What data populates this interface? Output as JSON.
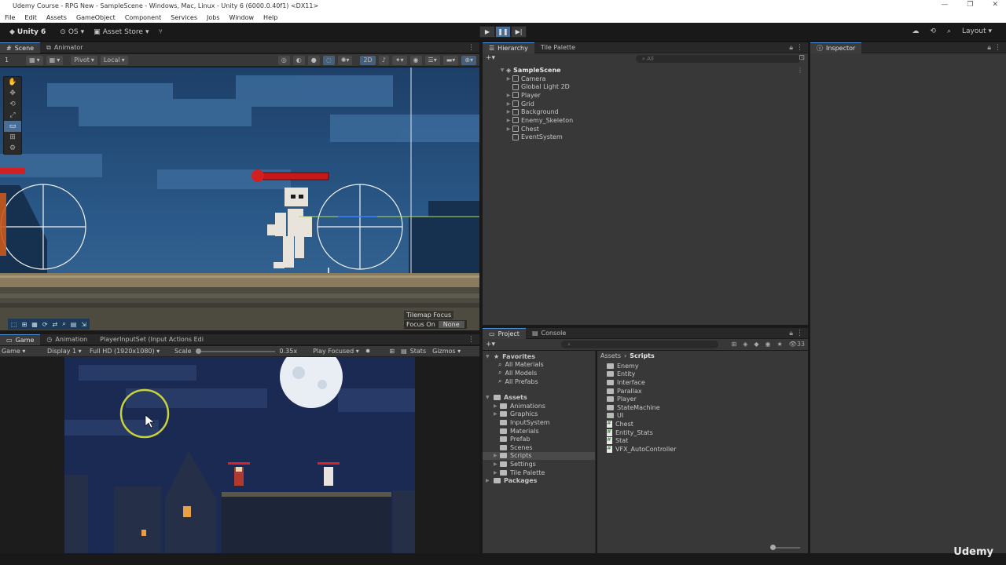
{
  "window": {
    "title": "Udemy Course - RPG New - SampleScene - Windows, Mac, Linux - Unity 6 (6000.0.40f1) <DX11>",
    "controls": [
      "—",
      "❐",
      "✕"
    ]
  },
  "menu": [
    "File",
    "Edit",
    "Assets",
    "GameObject",
    "Component",
    "Services",
    "Jobs",
    "Window",
    "Help"
  ],
  "toolbar": {
    "account": "Unity 6",
    "os": "OS",
    "asset_store": "Asset Store",
    "layout": "Layout"
  },
  "scene_panel": {
    "tabs": [
      "Scene",
      "Animator"
    ],
    "pivot": "Pivot",
    "local": "Local",
    "layer_num": "1",
    "mode_2d": "2D",
    "tilemap_focus": "Tilemap Focus",
    "focus_on_label": "Focus On",
    "focus_on_value": "None"
  },
  "game_panel": {
    "tabs": [
      "Game",
      "Animation",
      "PlayerInputSet (Input Actions Edi"
    ],
    "view_mode": "Game",
    "display": "Display 1",
    "resolution": "Full HD (1920x1080)",
    "scale_label": "Scale",
    "scale_value": "0.35x",
    "play_focused": "Play Focused",
    "stats": "Stats",
    "gizmos": "Gizmos"
  },
  "hierarchy": {
    "tabs": [
      "Hierarchy",
      "Tile Palette"
    ],
    "search_placeholder": "All",
    "scene": "SampleScene",
    "items": [
      "Camera",
      "Global Light 2D",
      "Player",
      "Grid",
      "Background",
      "Enemy_Skeleton",
      "Chest",
      "EventSystem"
    ]
  },
  "inspector": {
    "tab": "Inspector"
  },
  "project": {
    "tabs": [
      "Project",
      "Console"
    ],
    "favorites_label": "Favorites",
    "favorites": [
      "All Materials",
      "All Models",
      "All Prefabs"
    ],
    "assets_label": "Assets",
    "asset_folders": [
      "Animations",
      "Graphics",
      "InputSystem",
      "Materials",
      "Prefab",
      "Scenes",
      "Scripts",
      "Settings",
      "Tile Palette"
    ],
    "packages_label": "Packages",
    "breadcrumb": [
      "Assets",
      "Scripts"
    ],
    "folder_contents": [
      "Enemy",
      "Entity",
      "Interface",
      "Parallax",
      "Player",
      "StateMachine",
      "UI"
    ],
    "script_contents": [
      "Chest",
      "Entity_Stats",
      "Stat",
      "VFX_AutoController"
    ],
    "item_count": "33"
  },
  "watermark": "Udemy",
  "colors": {
    "accent": "#4a90d9",
    "selection": "#4a6d96",
    "panel": "#383838",
    "header": "#282828"
  }
}
